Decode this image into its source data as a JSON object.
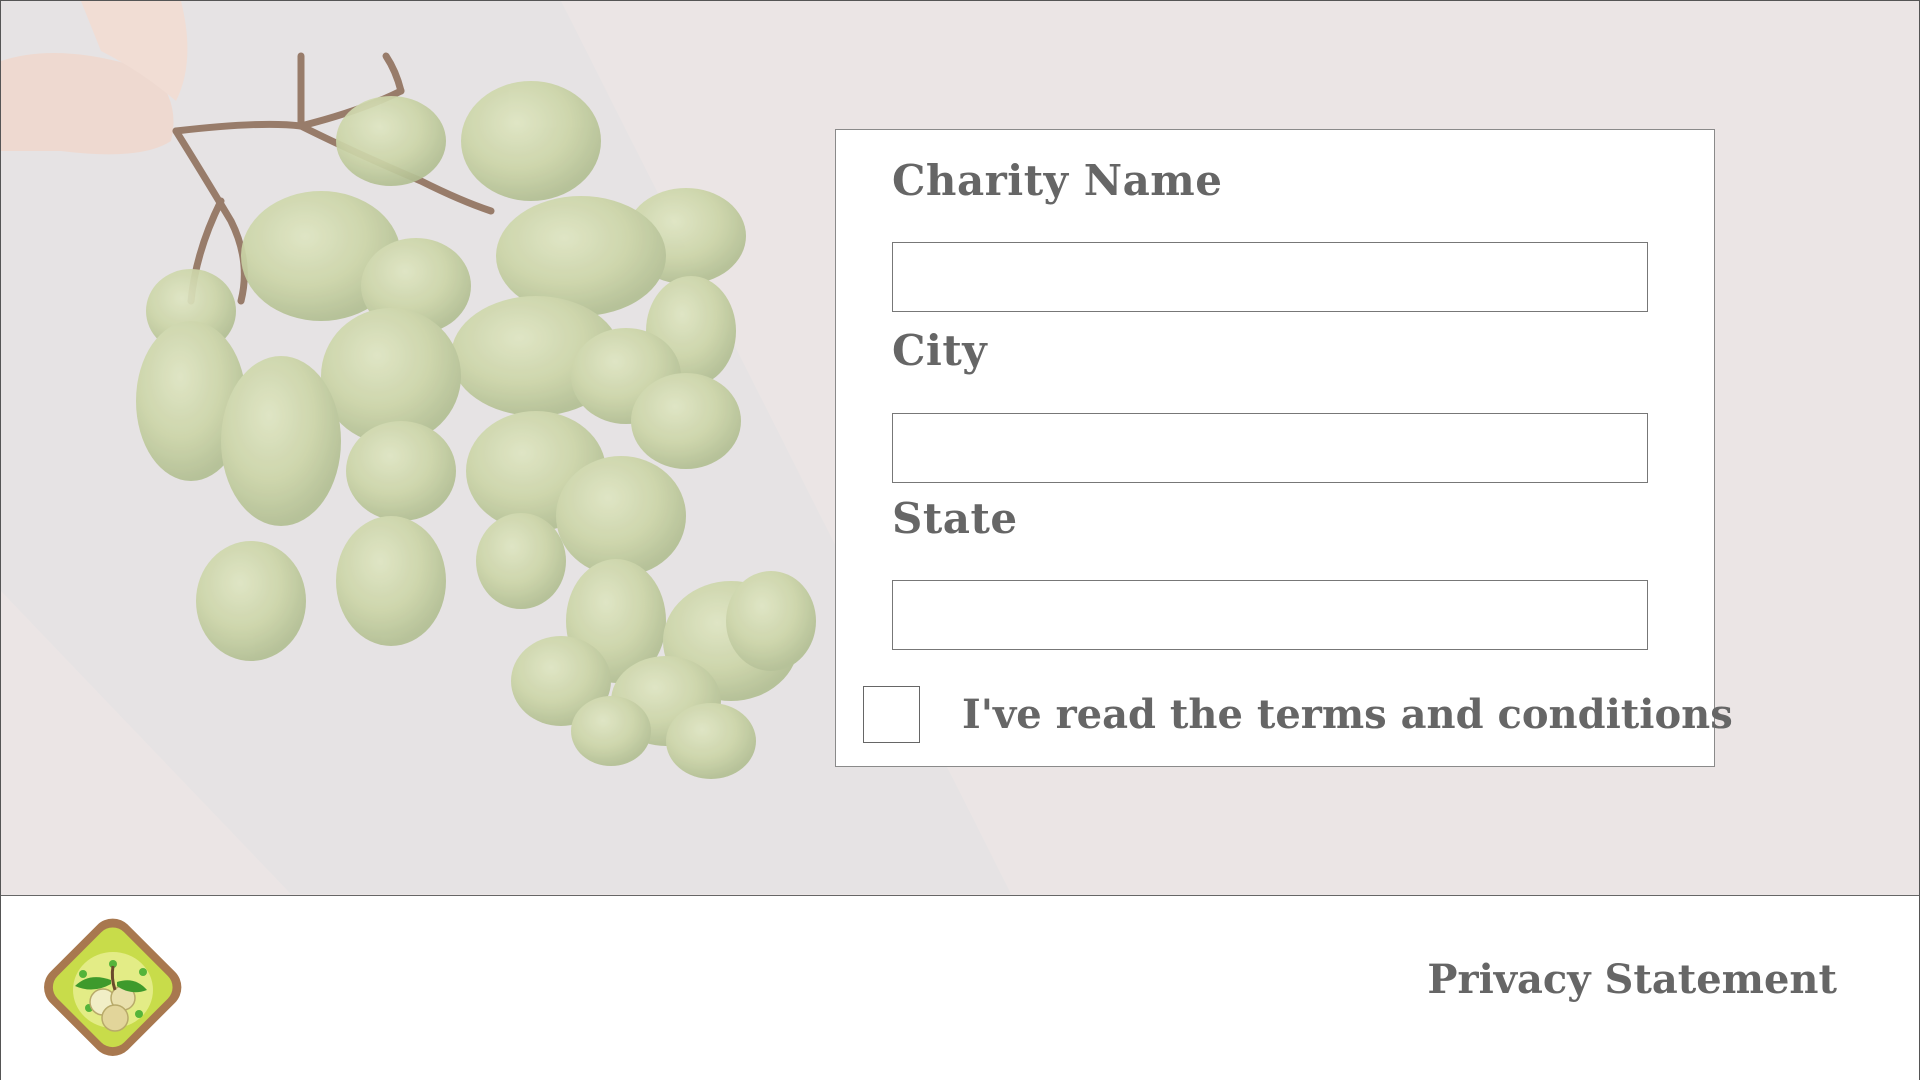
{
  "form": {
    "fields": [
      {
        "label": "Charity Name",
        "value": ""
      },
      {
        "label": "City",
        "value": ""
      },
      {
        "label": "State",
        "value": ""
      }
    ],
    "terms_label": "I've read the terms and conditions",
    "terms_checked": false
  },
  "footer": {
    "privacy_link": "Privacy Statement",
    "logo_icon": "grape-logo-icon"
  },
  "hero": {
    "image_icon": "green-grapes-photo"
  },
  "colors": {
    "background": "#ece6e6",
    "text": "#666666",
    "grape": "#c9d6a0"
  }
}
